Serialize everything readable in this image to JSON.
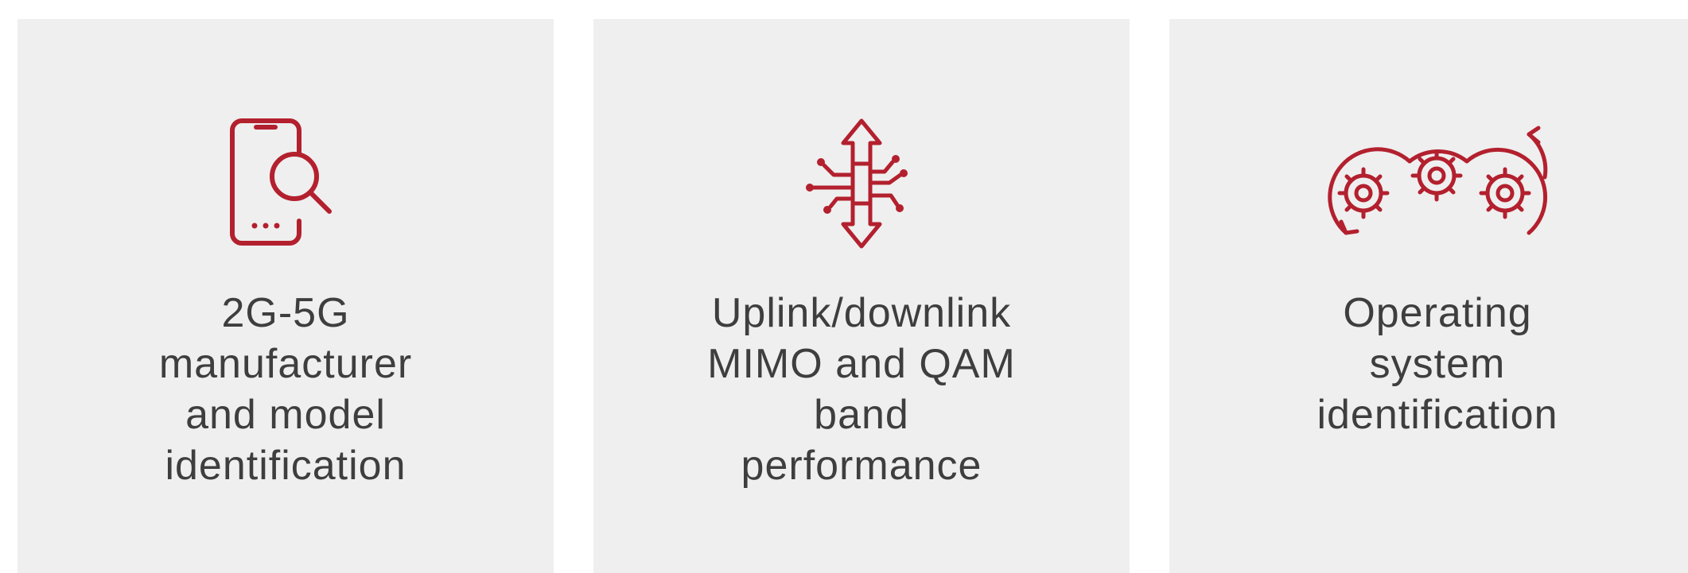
{
  "accent_color": "#b3202e",
  "tiles": [
    {
      "icon": "phone-search-icon",
      "lines": [
        "2G-5G",
        "manufacturer",
        "and model",
        "identification"
      ]
    },
    {
      "icon": "uplink-downlink-circuit-icon",
      "lines": [
        "Uplink/downlink",
        "MIMO and QAM",
        "band",
        "performance"
      ]
    },
    {
      "icon": "gears-cycle-icon",
      "lines": [
        "Operating",
        "system",
        "identification"
      ]
    }
  ]
}
